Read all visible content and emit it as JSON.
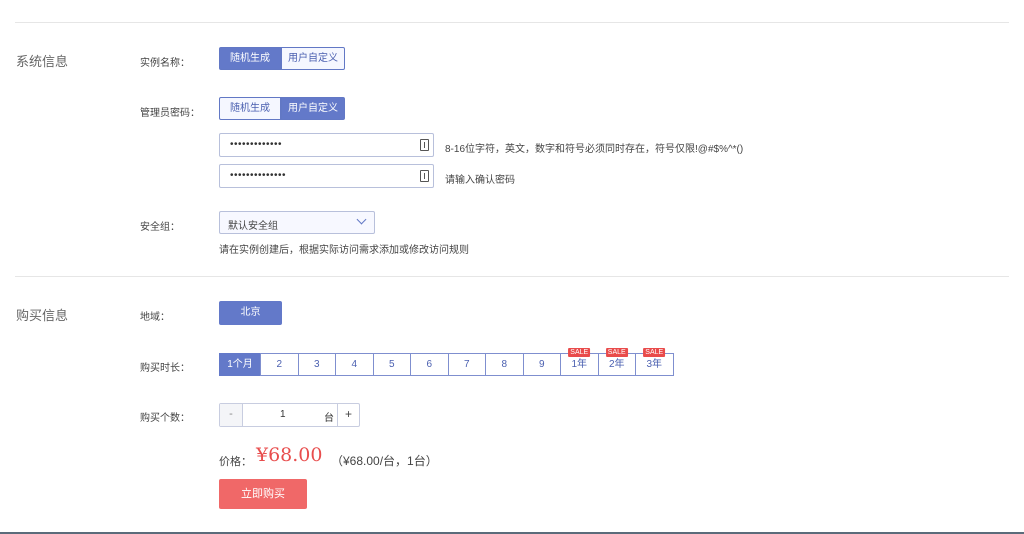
{
  "system_info": {
    "section_title": "系统信息",
    "instance_name": {
      "label": "实例名称：",
      "options": [
        "随机生成",
        "用户自定义"
      ],
      "selected": 0
    },
    "admin_password": {
      "label": "管理员密码：",
      "options": [
        "随机生成",
        "用户自定义"
      ],
      "selected": 1,
      "password_value": "•••••••••••••",
      "confirm_value": "••••••••••••••",
      "password_hint": "8-16位字符，英文，数字和符号必须同时存在，符号仅限!@#$%^*()",
      "confirm_hint": "请输入确认密码"
    },
    "security_group": {
      "label": "安全组：",
      "selected_value": "默认安全组",
      "hint": "请在实例创建后，根据实际访问需求添加或修改访问规则"
    }
  },
  "purchase_info": {
    "section_title": "购买信息",
    "region": {
      "label": "地域：",
      "value": "北京"
    },
    "duration": {
      "label": "购买时长：",
      "options": [
        {
          "text": "1个月",
          "sale": ""
        },
        {
          "text": "2",
          "sale": ""
        },
        {
          "text": "3",
          "sale": ""
        },
        {
          "text": "4",
          "sale": ""
        },
        {
          "text": "5",
          "sale": ""
        },
        {
          "text": "6",
          "sale": ""
        },
        {
          "text": "7",
          "sale": ""
        },
        {
          "text": "8",
          "sale": ""
        },
        {
          "text": "9",
          "sale": ""
        },
        {
          "text": "1年",
          "sale": "SALE"
        },
        {
          "text": "2年",
          "sale": "SALE"
        },
        {
          "text": "3年",
          "sale": "SALE"
        }
      ],
      "selected": 0
    },
    "quantity": {
      "label": "购买个数：",
      "minus": "-",
      "value": "1",
      "unit": "台",
      "plus": "+"
    },
    "price": {
      "label": "价格：",
      "amount": "¥68.00",
      "detail": "（¥68.00/台，1台）"
    },
    "buy_button": "立即购买"
  },
  "colors": {
    "accent": "#6379c9",
    "price": "#e84d4d",
    "buy_button": "#f06868",
    "sale_badge": "#e94b4b"
  }
}
